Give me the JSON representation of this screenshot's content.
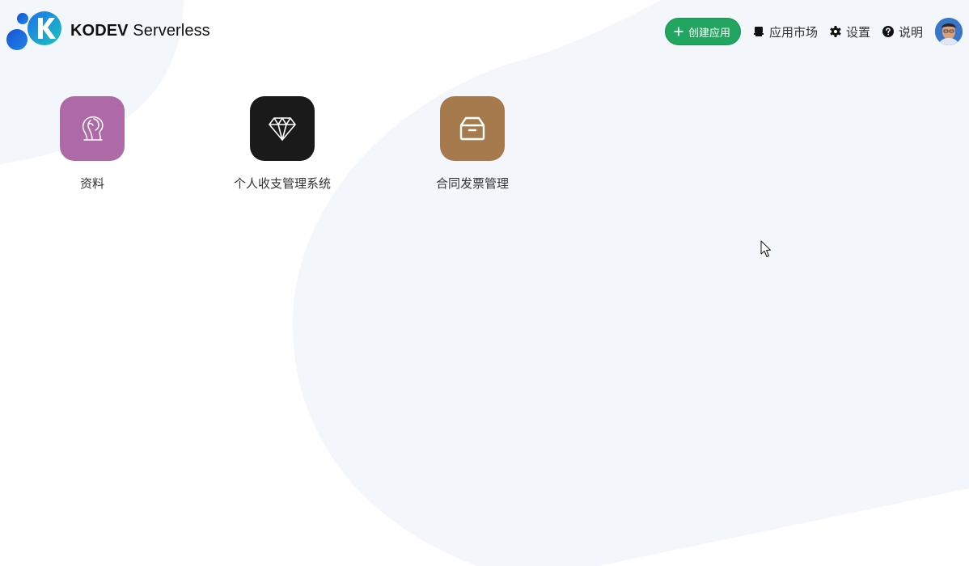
{
  "header": {
    "brand_strong": "KODEV",
    "brand_rest": "Serverless",
    "logo_icon": "kodev-logo-icon"
  },
  "nav": {
    "create_label": "创建应用",
    "items": [
      {
        "label": "应用市场",
        "icon": "store-icon"
      },
      {
        "label": "设置",
        "icon": "gear-icon"
      },
      {
        "label": "说明",
        "icon": "help-icon"
      }
    ],
    "avatar_icon": "user-avatar"
  },
  "apps": [
    {
      "label": "资料",
      "icon": "mind-icon",
      "color": "#ad6aa6"
    },
    {
      "label": "个人收支管理系统",
      "icon": "diamond-icon",
      "color": "#1a1a1a"
    },
    {
      "label": "合同发票管理",
      "icon": "archive-box-icon",
      "color": "#a67a4c"
    }
  ],
  "colors": {
    "accent": "#22a560",
    "background_shape": "#f3f6fb"
  }
}
